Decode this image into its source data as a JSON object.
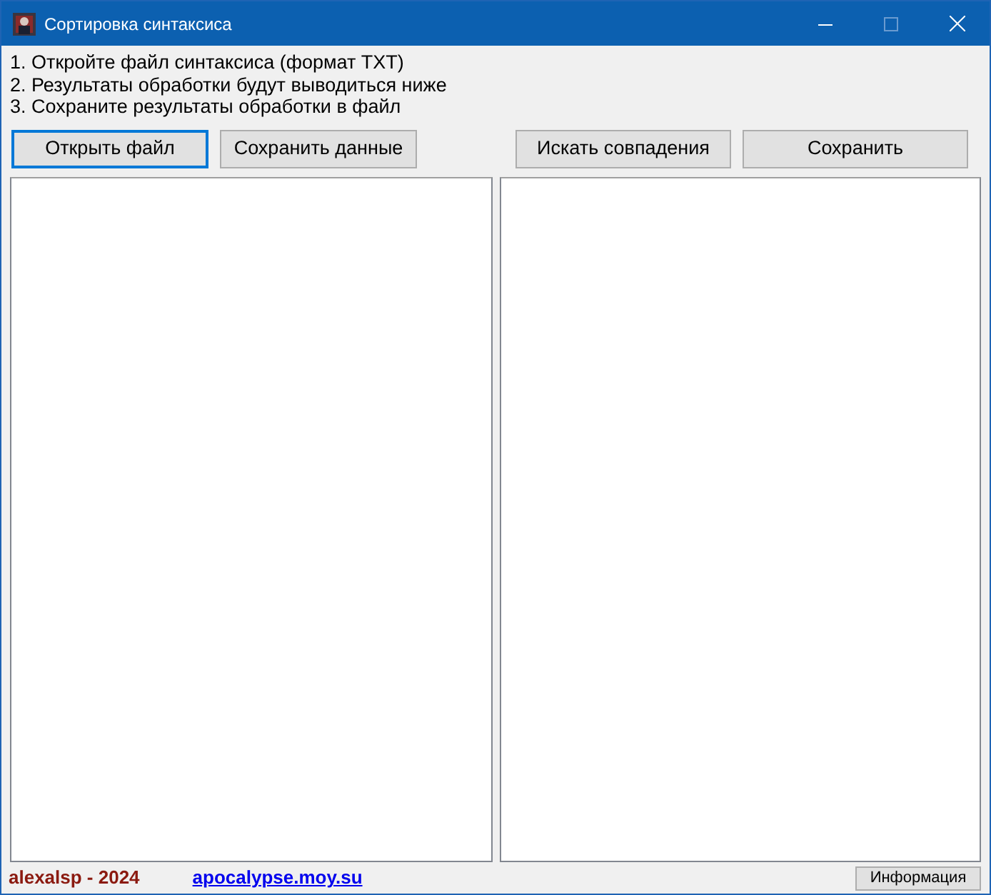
{
  "window": {
    "title": "Сортировка синтаксиса"
  },
  "instructions": [
    "1. Откройте файл синтаксиса (формат TXT)",
    "2. Результаты обработки будут выводиться ниже",
    "3. Сохраните результаты обработки в файл"
  ],
  "left_buttons": [
    {
      "label": "Открыть файл",
      "focused": true
    },
    {
      "label": "Сохранить данные",
      "focused": false
    }
  ],
  "right_buttons": [
    {
      "label": "Искать совпадения",
      "focused": false
    },
    {
      "label": "Сохранить",
      "focused": false
    }
  ],
  "footer": {
    "author": "alexalsp - 2024",
    "link": "apocalypse.moy.su",
    "button": "Информация"
  }
}
